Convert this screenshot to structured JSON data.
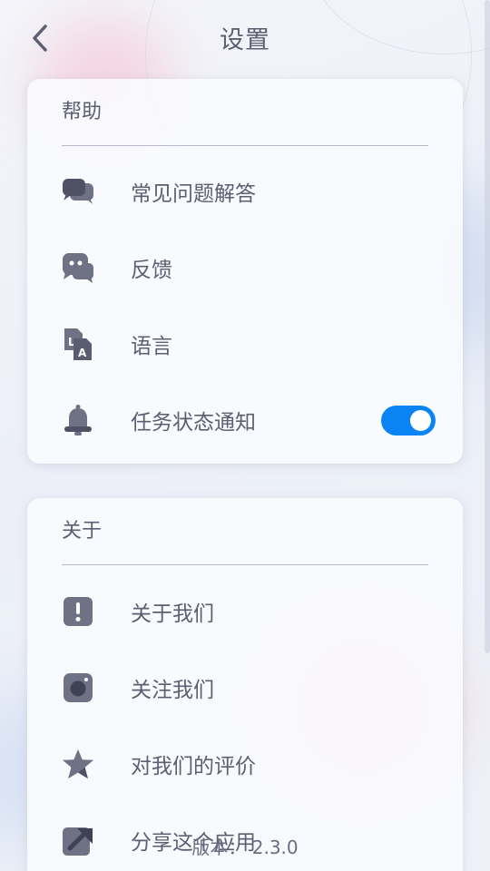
{
  "header": {
    "title": "设置"
  },
  "help_section": {
    "title": "帮助",
    "items": [
      {
        "label": "常见问题解答",
        "icon": "chat-bubbles-icon"
      },
      {
        "label": "反馈",
        "icon": "feedback-chat-icon"
      },
      {
        "label": "语言",
        "icon": "language-icon"
      },
      {
        "label": "任务状态通知",
        "icon": "bell-icon",
        "toggle_on": true
      }
    ]
  },
  "about_section": {
    "title": "关于",
    "items": [
      {
        "label": "关于我们",
        "icon": "info-exclamation-icon"
      },
      {
        "label": "关注我们",
        "icon": "instagram-icon"
      },
      {
        "label": "对我们的评价",
        "icon": "star-icon"
      },
      {
        "label": "分享这个应用",
        "icon": "share-arrow-icon"
      }
    ]
  },
  "footer": {
    "version": "版本： 2.3.0"
  },
  "colors": {
    "accent": "#0a84f5",
    "icon": "#6f7184",
    "text": "#5c5f72"
  }
}
